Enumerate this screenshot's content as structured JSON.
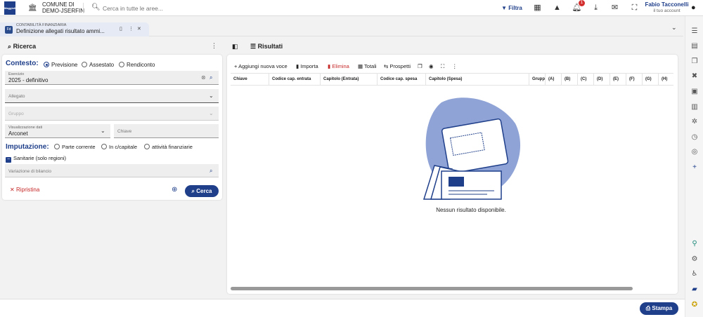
{
  "header": {
    "logo_text": "Maggioli",
    "municipality_line1": "COMUNE DI",
    "municipality_line2": "DEMO-JSERFIN",
    "search_placeholder": "Cerca in tutte le aree...",
    "filter_label": "Filtra",
    "notification_count": "1",
    "user_name": "Fabio Tacconelli",
    "user_sub": "il tuo account"
  },
  "tab": {
    "icon_text": "Fd",
    "category": "CONTABILITÀ FINANZIARIA",
    "title": "Definizione allegati risultato ammi..."
  },
  "search_panel": {
    "title": "Ricerca",
    "contesto_label": "Contesto:",
    "contesto_options": [
      "Previsione",
      "Assestato",
      "Rendiconto"
    ],
    "esercizio_label": "Esercizio",
    "esercizio_value": "2025 - definitivo",
    "allegato_placeholder": "Allegato",
    "gruppo_placeholder": "Gruppo",
    "visualizzazione_label": "Visualizzazione dati",
    "visualizzazione_value": "Arconet",
    "chiave_placeholder": "Chiave",
    "imputazione_label": "Imputazione:",
    "imputazione_options": [
      "Parte corrente",
      "In c/capitale",
      "attività finanziarie"
    ],
    "sanitarie_label": "Sanitarie (solo regioni)",
    "variazione_placeholder": "Variazione di bilancio",
    "ripristina_label": "Ripristina",
    "cerca_label": "Cerca"
  },
  "results": {
    "title": "Risultati",
    "toolbar": {
      "add": "Aggiungi nuova voce",
      "import": "Importa",
      "delete": "Elimina",
      "totals": "Totali",
      "prospetti": "Prospetti"
    },
    "columns": [
      "Chiave",
      "Codice cap. entrata",
      "Capitolo (Entrata)",
      "Codice cap. spesa",
      "Capitolo (Spesa)",
      "Grupp",
      "(A)",
      "(B)",
      "(C)",
      "(D)",
      "(E)",
      "(F)",
      "(G)",
      "(H)"
    ],
    "empty_message": "Nessun risultato disponibile."
  },
  "footer": {
    "stampa_label": "Stampa"
  },
  "colors": {
    "primary": "#1f3f8a",
    "danger": "#c62828",
    "illustration": "#8fa3d6"
  }
}
